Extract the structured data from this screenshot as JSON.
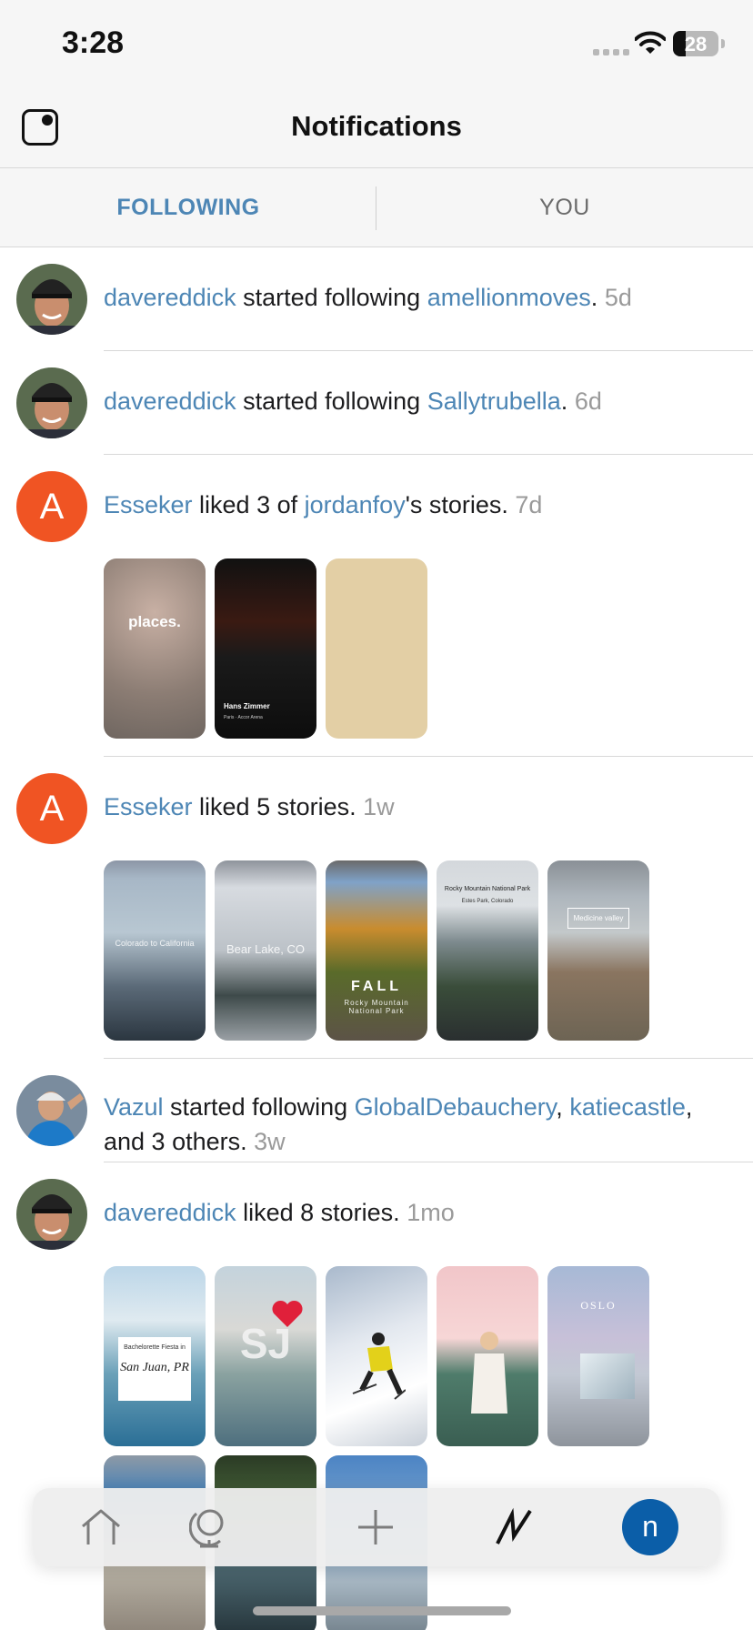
{
  "status_bar": {
    "time": "3:28",
    "battery": "28",
    "battery_level": 0.28
  },
  "header": {
    "title": "Notifications"
  },
  "tabs": [
    {
      "label": "FOLLOWING",
      "active": true
    },
    {
      "label": "YOU",
      "active": false
    }
  ],
  "notifications": [
    {
      "user": "davereddick",
      "action": " started following ",
      "target": "amellionmoves",
      "suffix": ".",
      "time": "5d"
    },
    {
      "user": "davereddick",
      "action": " started following ",
      "target": "Sallytrubella",
      "suffix": ".",
      "time": "6d"
    },
    {
      "avatar_letter": "A",
      "user": "Esseker",
      "action": " liked 3 of ",
      "target": "jordanfoy",
      "suffix": "'s stories.",
      "time": "7d",
      "thumbs": [
        {
          "title": "places."
        },
        {
          "title": "Hans Zimmer",
          "subtitle": "Paris · Accor Arena"
        },
        {
          "title": ""
        }
      ]
    },
    {
      "avatar_letter": "A",
      "user": "Esseker",
      "action": " liked 5 stories.",
      "time": "1w",
      "thumbs": [
        {
          "title": "Colorado to California"
        },
        {
          "title": "Bear Lake, CO"
        },
        {
          "title": "FALL",
          "subtitle": "Rocky Mountain National Park"
        },
        {
          "title": "Rocky Mountain National Park",
          "subtitle": "Estes Park, Colorado"
        },
        {
          "title": "Medicine valley"
        }
      ]
    },
    {
      "user": "Vazul",
      "action": " started following ",
      "target": "GlobalDebauchery",
      "mid": ",",
      "target2": "katiecastle",
      "suffix": ", and 3 others.",
      "time": "3w"
    },
    {
      "user": "davereddick",
      "action": " liked 8 stories.",
      "time": "1mo",
      "thumbs": [
        {
          "title": "Bachelorette Fiesta in",
          "subtitle": "San Juan, PR"
        },
        {
          "title": "SJ"
        },
        {
          "title": ""
        },
        {
          "title": ""
        },
        {
          "title": "OSLO"
        }
      ]
    }
  ],
  "tab_bar": {
    "profile_initial": "n"
  }
}
